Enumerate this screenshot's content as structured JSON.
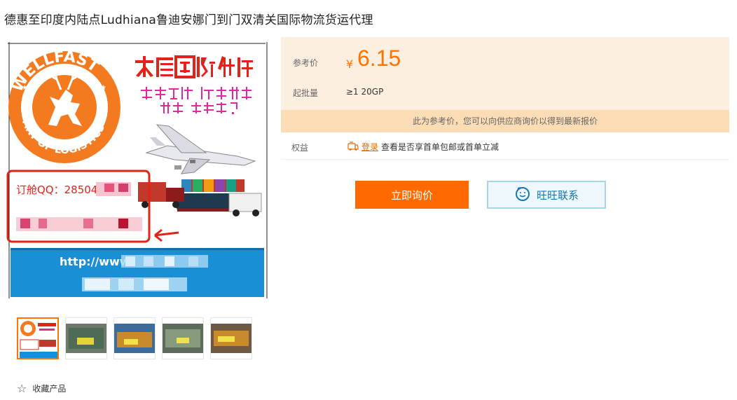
{
  "title": "德惠至印度内陆点Ludhiana鲁迪安娜门到门双清关国际物流货运代理",
  "main_image": {
    "logo_top": "WELLFAST",
    "logo_bottom": "ART OF LOGISTICS",
    "banner_line1": "大展国际物流",
    "banner_line2": "在线订舱  快速放舱",
    "banner_line3": "比快  还有谁？",
    "qq_text": "订舱QQ：28504",
    "url_text": "http://www"
  },
  "thumbnails": [
    {
      "label": "wellfast-poster"
    },
    {
      "label": "machine-1"
    },
    {
      "label": "machine-2"
    },
    {
      "label": "machine-3"
    },
    {
      "label": "machine-4"
    }
  ],
  "favorite_label": "收藏产品",
  "price": {
    "label": "参考价",
    "currency_symbol": "¥",
    "value": "6.15",
    "moq_label": "起批量",
    "moq_value": "≥1  20GP"
  },
  "notice": "此为参考价，您可以向供应商询价以得到最新报价",
  "rights": {
    "label": "权益",
    "login_link": "登录",
    "text": "查看是否享首单包邮或首单立减"
  },
  "buttons": {
    "inquire": "立即询价",
    "wangwang": "旺旺联系"
  },
  "colors": {
    "accent": "#ff6a00",
    "price_bg": "#fdefe0",
    "notice_bg": "#fbdcb5",
    "ww_text": "#1477b0"
  }
}
